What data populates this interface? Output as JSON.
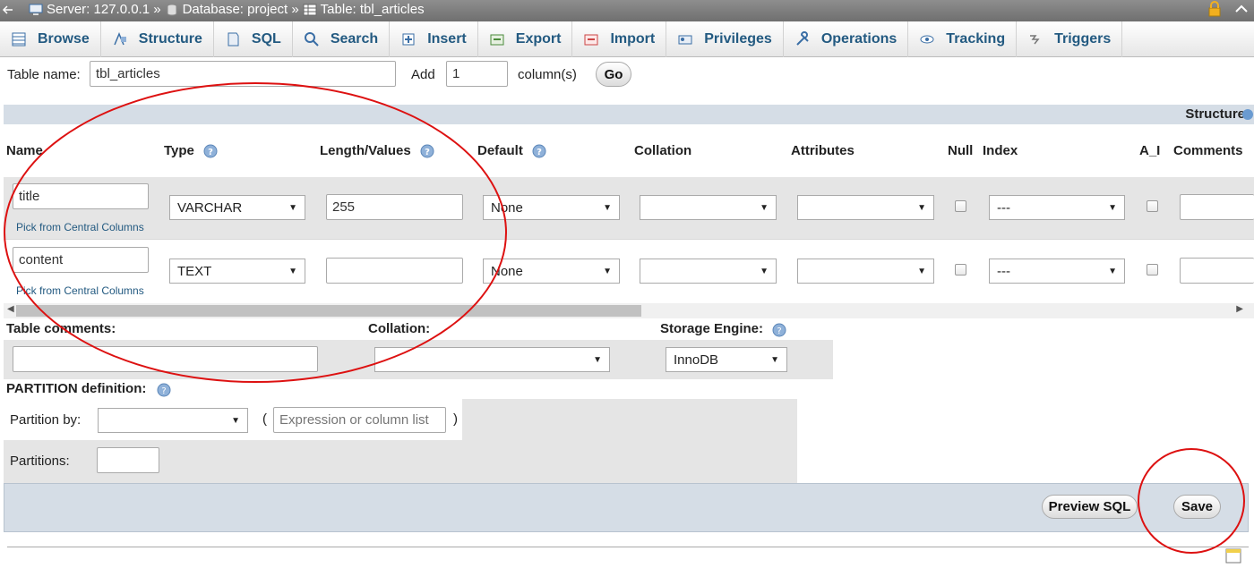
{
  "breadcrumb": {
    "server": "Server: 127.0.0.1 »",
    "database": "Database: project »",
    "table": "Table: tbl_articles"
  },
  "tabs": [
    {
      "label": "Browse",
      "icon": "browse-icon"
    },
    {
      "label": "Structure",
      "icon": "structure-icon"
    },
    {
      "label": "SQL",
      "icon": "sql-icon"
    },
    {
      "label": "Search",
      "icon": "search-icon"
    },
    {
      "label": "Insert",
      "icon": "insert-icon"
    },
    {
      "label": "Export",
      "icon": "export-icon"
    },
    {
      "label": "Import",
      "icon": "import-icon"
    },
    {
      "label": "Privileges",
      "icon": "privileges-icon"
    },
    {
      "label": "Operations",
      "icon": "wrench-icon"
    },
    {
      "label": "Tracking",
      "icon": "eye-icon"
    },
    {
      "label": "Triggers",
      "icon": "triggers-icon"
    }
  ],
  "tablename": {
    "label": "Table name:",
    "value": "tbl_articles",
    "add_label": "Add",
    "add_value": "1",
    "columns_label": "column(s)",
    "go": "Go"
  },
  "band": {
    "structure": "Structure"
  },
  "headers": {
    "name": "Name",
    "type": "Type",
    "length": "Length/Values",
    "default": "Default",
    "collation": "Collation",
    "attributes": "Attributes",
    "null": "Null",
    "index": "Index",
    "ai": "A_I",
    "comments": "Comments"
  },
  "rows": [
    {
      "name": "title",
      "pick": "Pick from Central Columns",
      "type": "VARCHAR",
      "length": "255",
      "default": "None",
      "index": "---"
    },
    {
      "name": "content",
      "pick": "Pick from Central Columns",
      "type": "TEXT",
      "length": "",
      "default": "None",
      "index": "---"
    }
  ],
  "table_options": {
    "comments_label": "Table comments:",
    "collation_label": "Collation:",
    "engine_label": "Storage Engine:",
    "engine_value": "InnoDB"
  },
  "partition": {
    "title": "PARTITION definition:",
    "by_label": "Partition by:",
    "open_paren": "(",
    "close_paren": ")",
    "expr_placeholder": "Expression or column list",
    "partitions_label": "Partitions:"
  },
  "footer": {
    "preview": "Preview SQL",
    "save": "Save"
  },
  "colors": {
    "link": "#235a81",
    "annotation": "#dd1111",
    "band": "#d5dde6"
  }
}
